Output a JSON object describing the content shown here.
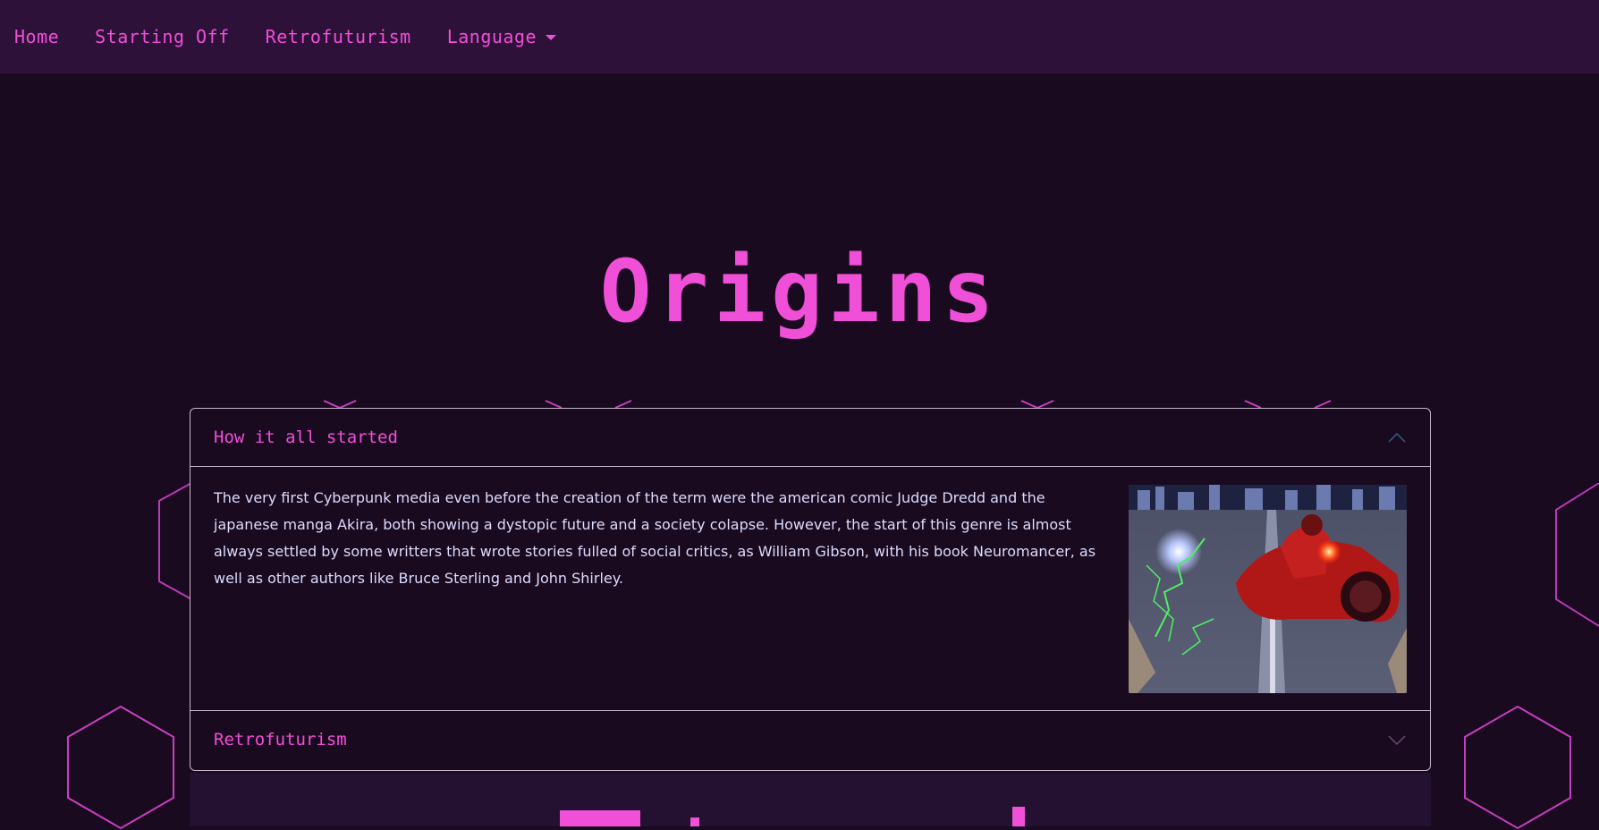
{
  "nav": {
    "items": [
      "Home",
      "Starting Off",
      "Retrofuturism",
      "Language"
    ]
  },
  "hero": {
    "title": "Origins"
  },
  "accordion": {
    "sections": [
      {
        "header": "How it all started",
        "body": "The very first Cyberpunk media even before the creation of the term were the american comic Judge Dredd and the japanese manga Akira, both showing a dystopic future and a society colapse. However, the start of this genre is almost always settled by some writters that wrote stories fulled of social critics, as William Gibson, with his book Neuromancer, as well as other authors like Bruce Sterling and John Shirley.",
        "expanded": true
      },
      {
        "header": "Retrofuturism",
        "expanded": false
      }
    ]
  },
  "colors": {
    "accent": "#f04fd8",
    "background": "#1a0a1f",
    "navbar": "#2d1138",
    "text": "#dcdcff"
  },
  "icons": [
    "chevron-up-icon",
    "chevron-down-icon",
    "caret-down-icon"
  ]
}
